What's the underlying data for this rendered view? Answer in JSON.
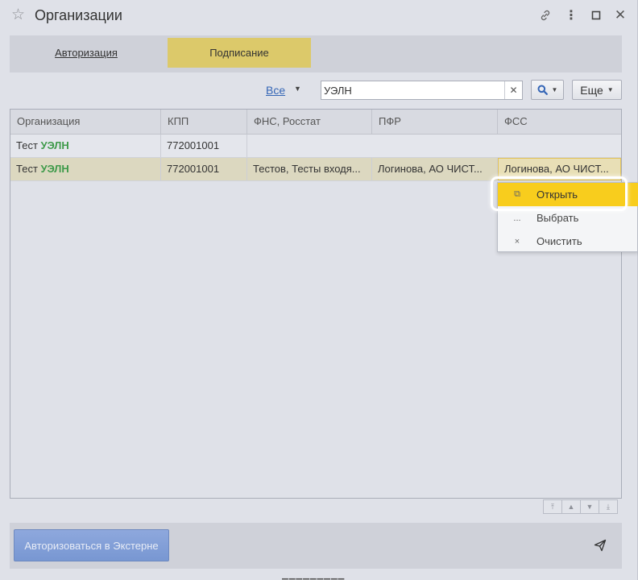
{
  "window": {
    "title": "Организации",
    "icons": [
      "star-icon",
      "link-icon",
      "more-vertical-icon",
      "maximize-icon",
      "close-icon"
    ]
  },
  "tabs": [
    {
      "label": "Авторизация",
      "active": false
    },
    {
      "label": "Подписание",
      "active": true
    }
  ],
  "toolbar": {
    "filter_label": "Все",
    "search_value": "УЭЛН",
    "more_label": "Еще"
  },
  "grid": {
    "columns": [
      "Организация",
      "КПП",
      "ФНС, Росстат",
      "ПФР",
      "ФСС"
    ],
    "rows": [
      {
        "org_prefix": "Тест",
        "org_highlight": "УЭЛН",
        "kpp": "772001001",
        "fns": "",
        "pfr": "",
        "fss": ""
      },
      {
        "org_prefix": "Тест",
        "org_highlight": "УЭЛН",
        "kpp": "772001001",
        "fns": "Тестов, Тесты входя...",
        "pfr": "Логинова, АО ЧИСТ...",
        "fss": "Логинова, АО ЧИСТ..."
      }
    ]
  },
  "context_menu": {
    "items": [
      {
        "label": "Открыть",
        "icon": "open-icon",
        "glyph": "⧉"
      },
      {
        "label": "Выбрать",
        "icon": "ellipsis-icon",
        "glyph": "..."
      },
      {
        "label": "Очистить",
        "icon": "clear-icon",
        "glyph": "×"
      }
    ]
  },
  "footer": {
    "extern_button": "Авторизоваться в Экстерне"
  },
  "colors": {
    "active_tab": "#dcc96a",
    "selected_row": "#dcd8c0",
    "menu_highlight": "#f8cd1d",
    "link": "#3566b6",
    "org_highlight": "#3e9a4a",
    "primary_button": "#7f9dd6"
  }
}
